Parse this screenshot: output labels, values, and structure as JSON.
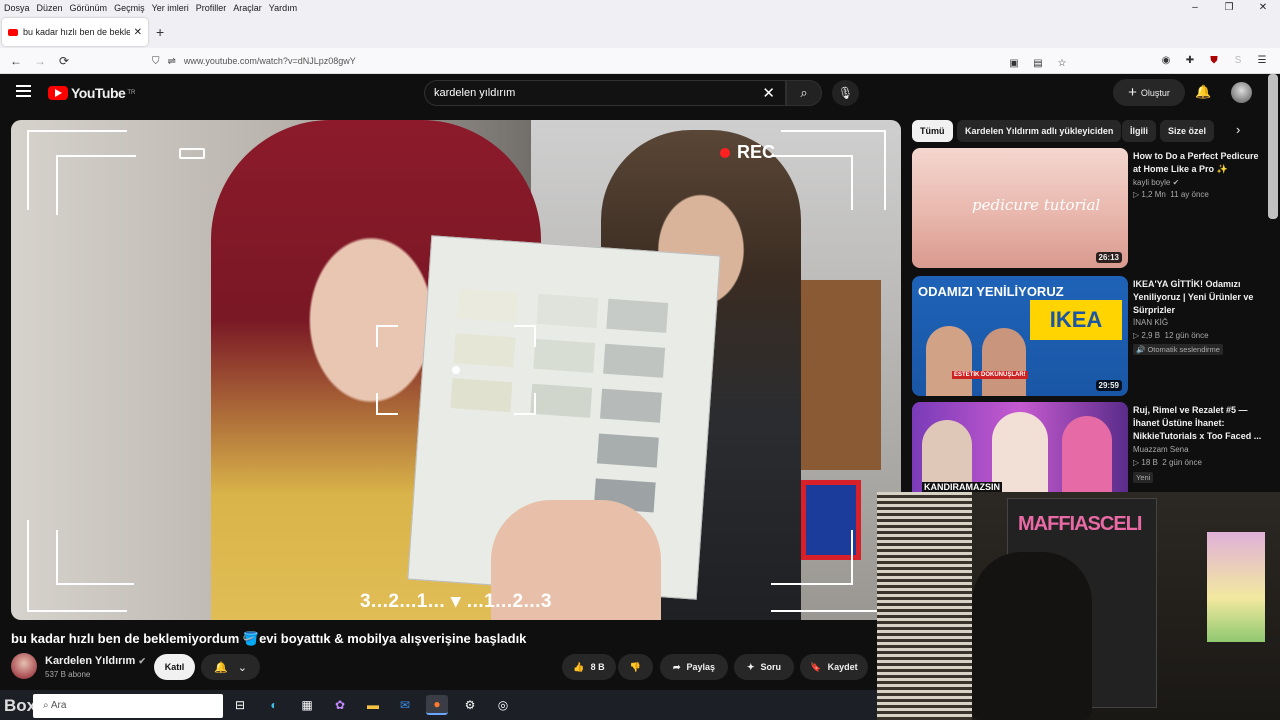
{
  "menubar": [
    "Dosya",
    "Düzen",
    "Görünüm",
    "Geçmiş",
    "Yer imleri",
    "Profiller",
    "Araçlar",
    "Yardım"
  ],
  "window_controls": [
    "–",
    "❐",
    "✕"
  ],
  "tab": {
    "title": "bu kadar hızlı ben de beklemiyor",
    "close": "✕",
    "new": "+"
  },
  "nav": {
    "back": "←",
    "forward": "→",
    "reload": "⟳",
    "url": "www.youtube.com/watch?v=dNJLpz08gwY"
  },
  "youtube": {
    "logo": "YouTube",
    "region": "TR",
    "search_value": "kardelen yıldırım",
    "create_label": "Oluştur",
    "video_title": "bu kadar hızlı ben de beklemiyordum 🪣evi boyattık & mobilya alışverişine başladık",
    "channel_name": "Kardelen Yıldırım",
    "channel_subs": "537 B abone",
    "join_label": "Katıl",
    "likes": "8 B",
    "share_label": "Paylaş",
    "ask_label": "Soru",
    "save_label": "Kaydet",
    "player_overlay": {
      "rec": "REC",
      "countdown": "3...2...1...  ▾  ...1...2...3"
    }
  },
  "chips": [
    "Tümü",
    "Kardelen Yıldırım adlı yükleyiciden",
    "İlgili",
    "Size özel"
  ],
  "recommendations": [
    {
      "title": "How to Do a Perfect Pedicure at Home Like a Pro ✨",
      "channel": "kayli boyle",
      "views": "1,2 Mn",
      "age": "11 ay önce",
      "duration": "26:13",
      "thumb_text": "pedicure tutorial",
      "badge": ""
    },
    {
      "title": "IKEA'YA GİTTİK! Odamızı Yeniliyoruz | Yeni Ürünler ve Sürprizler",
      "channel": "İNAN KİĞ",
      "views": "2,9 B",
      "age": "12 gün önce",
      "duration": "29:59",
      "thumb_text": "ODAMIZI YENİLİYORUZ",
      "thumb_sub": "IKEA",
      "thumb_note": "ESTETİK DOKUNUŞLAR!",
      "badge": "Otomatik seslendirme"
    },
    {
      "title": "Ruj, Rimel ve Rezalet #5 — İhanet Üstüne İhanet: NikkieTutorials x Too Faced ...",
      "channel": "Muazzam Sena",
      "views": "18 B",
      "age": "2 gün önce",
      "duration": "",
      "thumb_text": "KANDIRAMAZSIN",
      "badge": "Yeni"
    }
  ],
  "webcam": {
    "banner_text": "MAFFIASCELI"
  },
  "taskbar": {
    "search_placeholder": "Ara",
    "watermark": "BoxGame"
  },
  "colors": {
    "yt_bg": "#0f0f0f",
    "yt_red": "#ff0000",
    "chip_active": "#f1f1f1",
    "chip": "#272727"
  }
}
